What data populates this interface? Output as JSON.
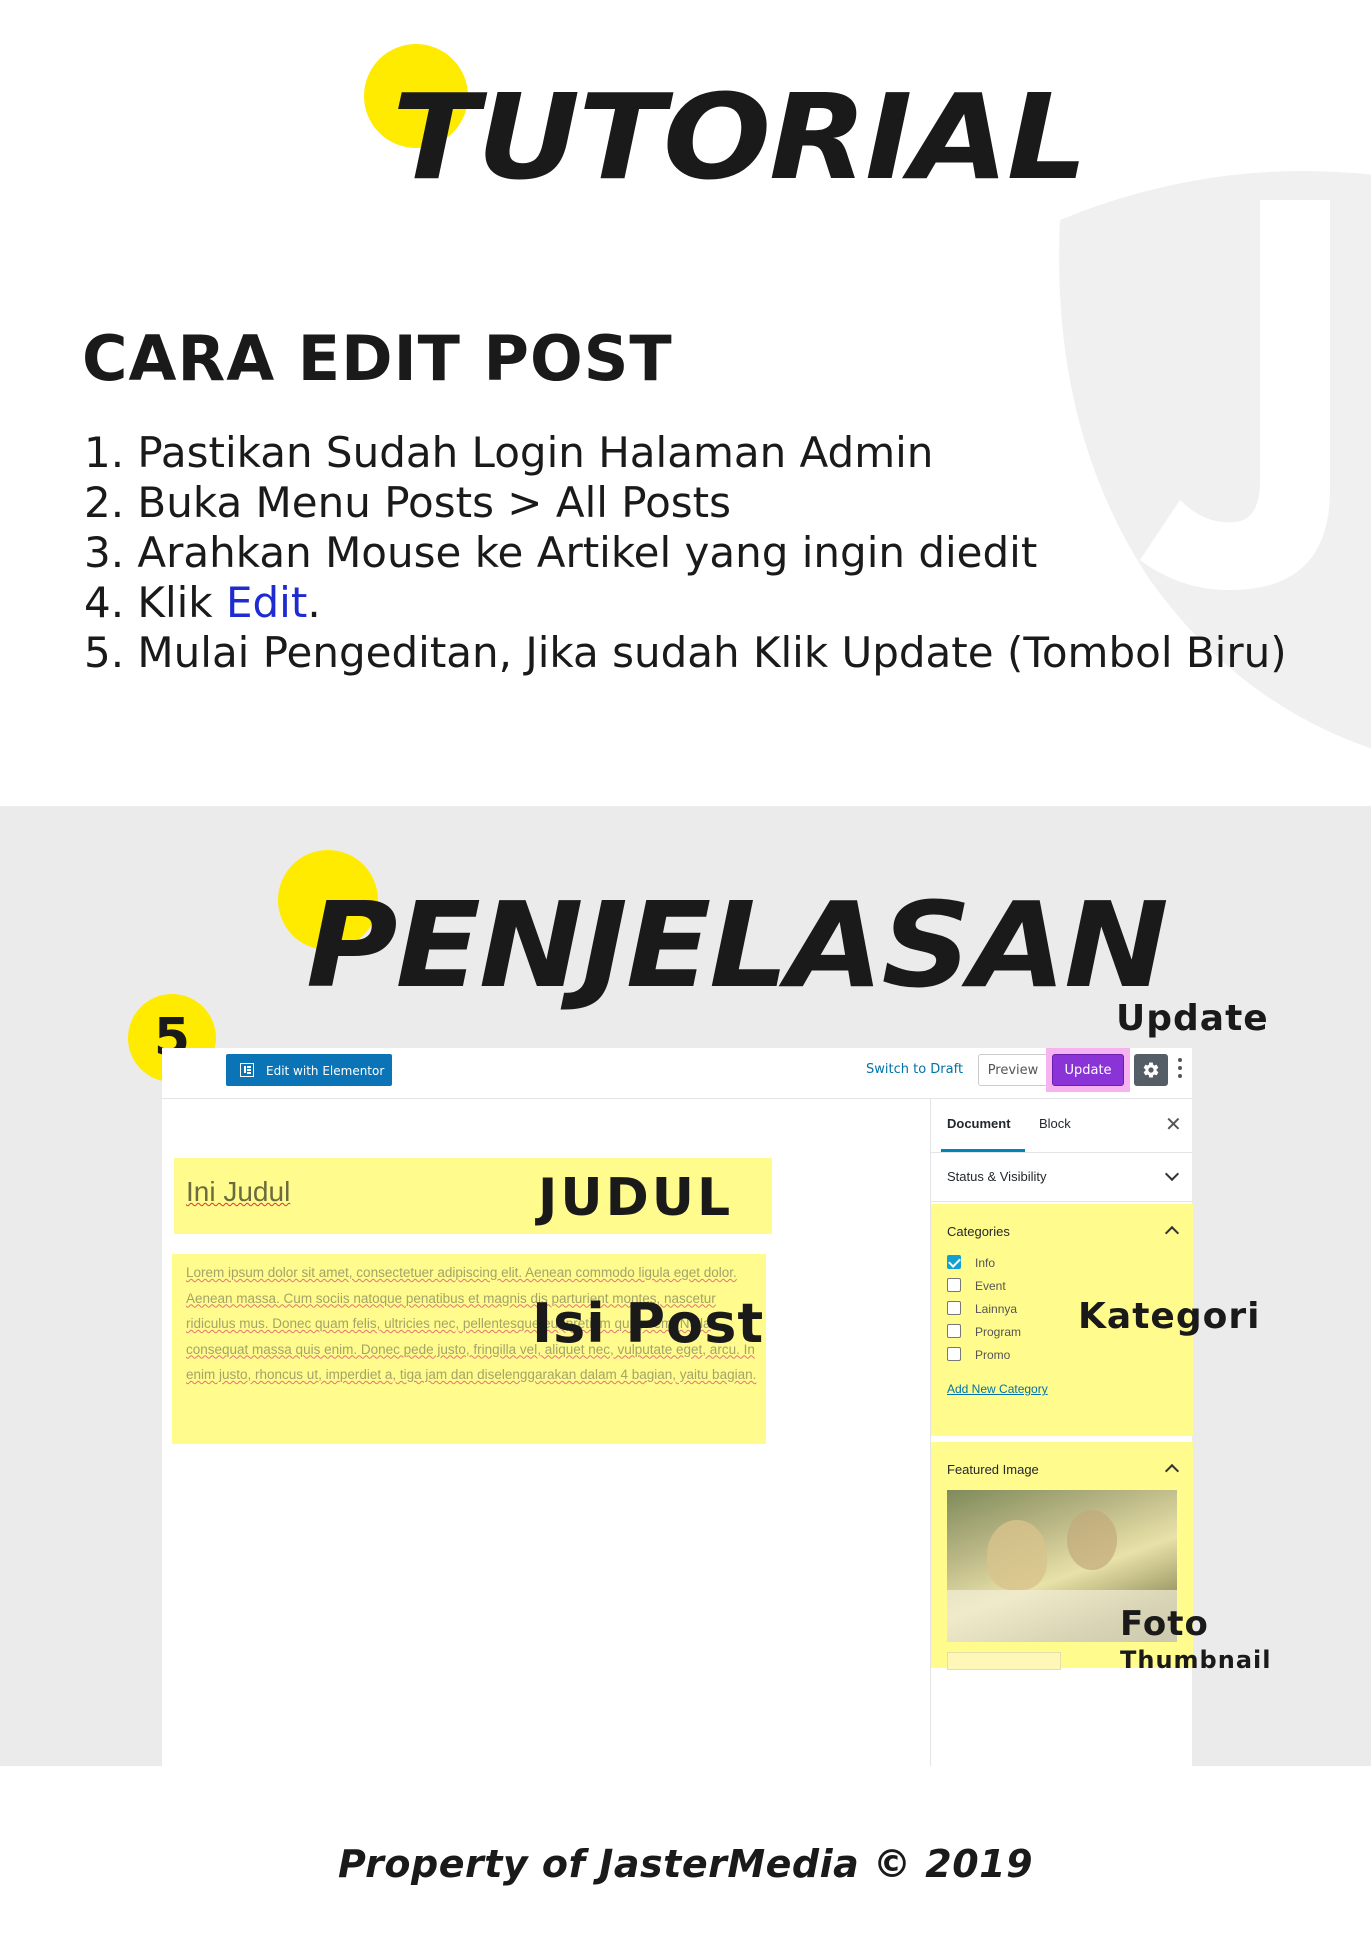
{
  "header": {
    "title": "TUTORIAL"
  },
  "guide": {
    "heading": "CARA EDIT POST",
    "steps": [
      {
        "text": "1. Pastikan Sudah Login Halaman Admin"
      },
      {
        "text": "2. Buka Menu Posts > All Posts"
      },
      {
        "text": "3. Arahkan Mouse ke Artikel yang ingin diedit"
      },
      {
        "prefix": "4. Klik ",
        "link": "Edit",
        "suffix": "."
      },
      {
        "text": "5. Mulai Pengeditan, Jika sudah Klik Update (Tombol Biru)"
      }
    ],
    "link_color": "#1f2bd1"
  },
  "explanation": {
    "title": "PENJELASAN",
    "step_number": "5",
    "annotations": {
      "update": "Update",
      "judul": "JUDUL",
      "isi_post": "Isi Post",
      "kategori": "Kategori",
      "foto": "Foto",
      "thumbnail": "Thumbnail"
    },
    "highlight_color": "#fffb8c",
    "accent_yellow": "#ffeb00"
  },
  "editor": {
    "toolbar": {
      "elementor_label": "Edit with Elementor",
      "switch_draft_label": "Switch to Draft",
      "preview_label": "Preview",
      "update_label": "Update",
      "settings_icon": "gear-icon",
      "more_icon": "kebab-icon"
    },
    "post": {
      "title": "Ini Judul",
      "body": "Lorem ipsum dolor sit amet, consectetuer adipiscing elit. Aenean commodo ligula eget dolor. Aenean massa. Cum sociis natoque penatibus et magnis dis parturient montes, nascetur ridiculus mus. Donec quam felis, ultricies nec, pellentesque eu, pretium quis, sem. Nulla consequat massa quis enim. Donec pede justo, fringilla vel, aliquet nec, vulputate eget, arcu. In enim justo, rhoncus ut, imperdiet a, tiga jam dan diselenggarakan dalam 4 bagian, yaitu bagian."
    },
    "sidebar": {
      "tabs": [
        {
          "label": "Document",
          "active": true
        },
        {
          "label": "Block",
          "active": false
        }
      ],
      "close_icon": "close-icon",
      "status_label": "Status & Visibility",
      "categories_label": "Categories",
      "categories": [
        {
          "label": "Info",
          "checked": true
        },
        {
          "label": "Event",
          "checked": false
        },
        {
          "label": "Lainnya",
          "checked": false
        },
        {
          "label": "Program",
          "checked": false
        },
        {
          "label": "Promo",
          "checked": false
        }
      ],
      "add_category_label": "Add New Category",
      "featured_label": "Featured Image"
    },
    "update_highlight_color": "#f7b3f0",
    "update_button_color": "#8a33d6"
  },
  "footer": {
    "text": "Property of JasterMedia © 2019"
  }
}
